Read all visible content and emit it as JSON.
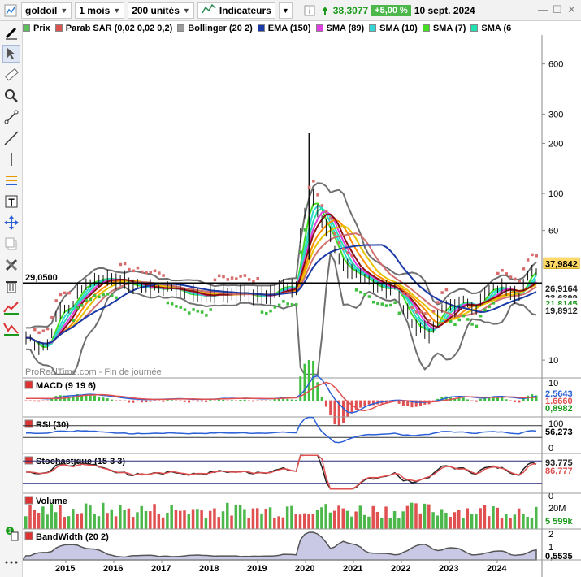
{
  "toolbar": {
    "symbol": "goldoil",
    "period": "1 mois",
    "units": "200 unités",
    "indicators_label": "Indicateurs",
    "price": "38,3077",
    "change": "+5,00 %",
    "date": "10 sept. 2024"
  },
  "legend": [
    {
      "label": "Prix",
      "color": "#5cbf5c"
    },
    {
      "label": "Parab SAR (0,02 0,02 0,2)",
      "color": "#d9534f"
    },
    {
      "label": "Bollinger (20 2)",
      "color": "#9a9a9a"
    },
    {
      "label": "EMA (150)",
      "color": "#1a3aa8"
    },
    {
      "label": "SMA (89)",
      "color": "#e040e0"
    },
    {
      "label": "SMA (10)",
      "color": "#33d6d6"
    },
    {
      "label": "SMA (7)",
      "color": "#44dd22"
    },
    {
      "label": "SMA (6",
      "color": "#22e0b0"
    }
  ],
  "tools": [
    "pencil-icon",
    "cursor-icon",
    "ruler-icon",
    "zoom-icon",
    "segment-icon",
    "line-icon",
    "vertical-line-icon",
    "fibonacci-icon",
    "text-icon",
    "move-icon",
    "copy-icon",
    "settings-tools-icon",
    "trash-icon",
    "indicator-red-icon",
    "indicator-green-icon"
  ],
  "main_chart": {
    "watermark": "ProRealTime.com - Fin de journée",
    "hline_label": "29,0500",
    "y_ticks": [
      "600",
      "300",
      "200",
      "100",
      "60",
      "10"
    ],
    "price_tags": [
      {
        "text": "37,9842",
        "bg": "#ffd966",
        "color": "#000"
      },
      {
        "text": "26,9164",
        "bg": "#ffffff",
        "color": "#222"
      },
      {
        "text": "23,6399",
        "bg": "#ffffff",
        "color": "#222"
      },
      {
        "text": "21,8145",
        "bg": "#ffffff",
        "color": "#1a9a1a"
      },
      {
        "text": "19,8912",
        "bg": "#ffffff",
        "color": "#222"
      }
    ]
  },
  "panels": {
    "macd": {
      "label": "MACD (9 19 6)",
      "ticks": [
        "10"
      ],
      "values": [
        "2,5643",
        "1,6660",
        "0,8982"
      ]
    },
    "rsi": {
      "label": "RSI (30)",
      "ticks": [
        "100",
        "0"
      ],
      "value": "56,273"
    },
    "stoch": {
      "label": "Stochastique (15 3 3)",
      "ticks": [
        "0"
      ],
      "values": [
        "93,775",
        "86,777"
      ]
    },
    "volume": {
      "label": "Volume",
      "ticks": [
        "20M"
      ],
      "value": "5 599k"
    },
    "bandwidth": {
      "label": "BandWidth (20 2)",
      "ticks": [
        "2",
        "1"
      ],
      "value": "0,5535"
    }
  },
  "x_axis": [
    "2015",
    "2016",
    "2017",
    "2018",
    "2019",
    "2020",
    "2021",
    "2022",
    "2023",
    "2024"
  ]
}
